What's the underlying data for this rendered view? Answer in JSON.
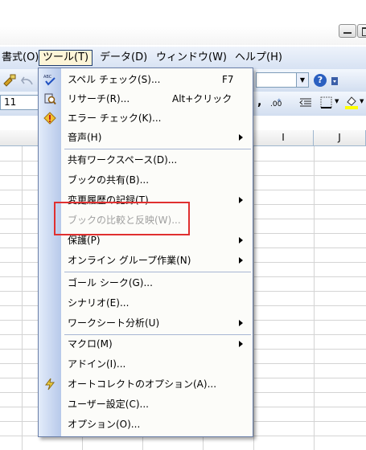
{
  "menubar": {
    "items": [
      {
        "label": "書式(O)"
      },
      {
        "label": "ツール(T)"
      },
      {
        "label": "データ(D)"
      },
      {
        "label": "ウィンドウ(W)"
      },
      {
        "label": "ヘルプ(H)"
      }
    ]
  },
  "toolbar": {
    "font_size_value": "11"
  },
  "grid": {
    "columns": [
      "I",
      "J"
    ]
  },
  "tools_menu": {
    "items": [
      {
        "label": "スペル チェック(S)...",
        "shortcut": "F7"
      },
      {
        "label": "リサーチ(R)...",
        "shortcut": "Alt+クリック"
      },
      {
        "label": "エラー チェック(K)..."
      },
      {
        "label": "音声(H)"
      },
      {
        "label": "共有ワークスペース(D)..."
      },
      {
        "label": "ブックの共有(B)..."
      },
      {
        "label": "変更履歴の記録(T)"
      },
      {
        "label": "ブックの比較と反映(W)..."
      },
      {
        "label": "保護(P)"
      },
      {
        "label": "オンライン グループ作業(N)"
      },
      {
        "label": "ゴール シーク(G)..."
      },
      {
        "label": "シナリオ(E)..."
      },
      {
        "label": "ワークシート分析(U)"
      },
      {
        "label": "マクロ(M)"
      },
      {
        "label": "アドイン(I)..."
      },
      {
        "label": "オートコレクトのオプション(A)..."
      },
      {
        "label": "ユーザー設定(C)..."
      },
      {
        "label": "オプション(O)..."
      }
    ]
  },
  "colors": {
    "highlight_border": "#e03030",
    "menu_gutter": "#b7c9ea"
  }
}
